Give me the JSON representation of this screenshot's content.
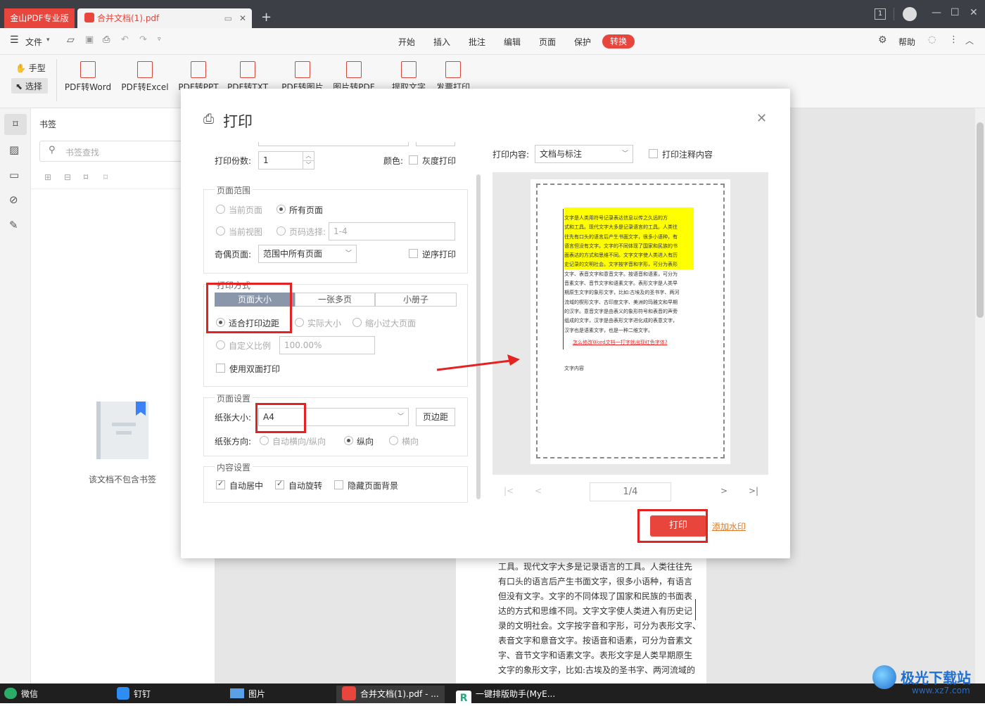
{
  "window": {
    "app_tab": "金山PDF专业版",
    "doc_tab": "合并文档(1).pdf",
    "badge": "1"
  },
  "menu": {
    "file": "文件",
    "tabs": [
      "开始",
      "插入",
      "批注",
      "编辑",
      "页面",
      "保护"
    ],
    "convert": "转换",
    "help": "帮助"
  },
  "toolbar": {
    "hand": "手型",
    "select": "选择",
    "buttons": [
      "PDF转Word",
      "PDF转Excel",
      "PDF转PPT",
      "PDF转TXT",
      "PDF转图片",
      "图片转PDF",
      "提取文字",
      "发票打印"
    ]
  },
  "sidebar": {
    "title": "书签",
    "search_placeholder": "书签查找",
    "empty_text": "该文档不包含书签"
  },
  "dialog": {
    "title": "打印",
    "copies_label": "打印份数:",
    "copies_value": "1",
    "color_label": "颜色:",
    "grayscale_label": "灰度打印",
    "range": {
      "legend": "页面范围",
      "current_page": "当前页面",
      "all_pages": "所有页面",
      "current_view": "当前视图",
      "page_select": "页码选择:",
      "page_select_value": "1-4",
      "odd_even_label": "奇偶页面:",
      "odd_even_value": "范围中所有页面",
      "reverse": "逆序打印"
    },
    "mode": {
      "legend": "打印方式",
      "tabs": [
        "页面大小",
        "一张多页",
        "小册子"
      ],
      "fit_margin": "适合打印边距",
      "actual_size": "实际大小",
      "shrink_large": "缩小过大页面",
      "custom_scale": "自定义比例",
      "scale_value": "100.00%",
      "duplex": "使用双面打印"
    },
    "page_setup": {
      "legend": "页面设置",
      "paper_size_label": "纸张大小:",
      "paper_size_value": "A4",
      "margins_button": "页边距",
      "orientation_label": "纸张方向:",
      "auto": "自动横向/纵向",
      "portrait": "纵向",
      "landscape": "横向"
    },
    "content": {
      "legend": "内容设置",
      "auto_center": "自动居中",
      "auto_rotate": "自动旋转",
      "hide_bg": "隐藏页面背景"
    },
    "preview": {
      "print_content_label": "打印内容:",
      "print_content_value": "文档与标注",
      "print_annotations": "打印注释内容",
      "page_indicator": "1/4"
    },
    "print_button": "打印",
    "watermark_link": "添加水印"
  },
  "preview_doc": {
    "lines": [
      "文字是人类用符号记录表达信息以传之久远的方",
      "式和工具。现代文字大多是记录语言的工具。人类往",
      "往先有口头的语言后产生书面文字，很多小语种，有",
      "语言但没有文字。文字的不同体现了国家和民族的书",
      "面表达的方式和思维不同。文字文字使人类进入有历",
      "史记录的文明社会。文字按字音和字形，可分为表形",
      "文字、表音文字和意音文字。按语音和语素，可分为",
      "音素文字、音节文字和语素文字。表形文字是人类早",
      "期原生文字的象形文字，比如:古埃及的圣书字、两河",
      "流域的楔形文字、古印度文字、美洲的玛雅文和早期",
      "的汉字。意音文字是由表义的象形符号和表音的声旁",
      "组成的文字，汉字是由表形文字进化成的表意文字，",
      "汉字也是语素文字，也是一种二维文字。"
    ],
    "link": "怎么修改Word文档一打字就出现红色字体?",
    "footer": "文字内容"
  },
  "page_behind": {
    "lines": [
      "工具。现代文字大多是记录语言的工具。人类往往先",
      "有口头的语言后产生书面文字，很多小语种，有语言",
      "但没有文字。文字的不同体现了国家和民族的书面表",
      "达的方式和思维不同。文字文字使人类进入有历史记",
      "录的文明社会。文字按字音和字形，可分为表形文字、",
      "表音文字和意音文字。按语音和语素，可分为音素文",
      "字、音节文字和语素文字。表形文字是人类早期原生",
      "文字的象形文字，比如:古埃及的圣书字、两河流域的"
    ]
  },
  "taskbar": {
    "items": [
      "微信",
      "钉钉",
      "图片",
      "合并文档(1).pdf - ...",
      "一键排版助手(MyE..."
    ]
  },
  "watermark_brand": {
    "name": "极光下载站",
    "url": "www.xz7.com"
  },
  "colors": {
    "accent": "#e8453c",
    "highlight": "#ffff00",
    "selected_tab": "#8a96aa",
    "annotation_red": "#e52222"
  }
}
